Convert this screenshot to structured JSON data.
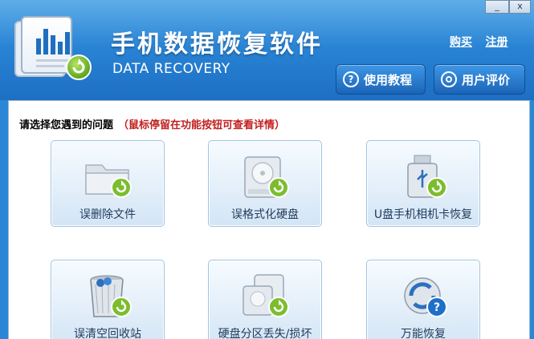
{
  "header": {
    "title": "手机数据恢复软件",
    "subtitle": "DATA RECOVERY",
    "links": {
      "buy": "购买",
      "register": "注册"
    },
    "tutorial_label": "使用教程",
    "review_label": "用户评价",
    "accent_color": "#2b86d6"
  },
  "window": {
    "minimize": "_",
    "close": "x"
  },
  "main": {
    "prompt": "请选择您遇到的问题",
    "hint": "（鼠标停留在功能按钮可查看详情）",
    "hint_color": "#c21f1f",
    "tiles": [
      {
        "label": "误删除文件",
        "icon": "folder-recover-icon"
      },
      {
        "label": "误格式化硬盘",
        "icon": "hard-drive-recover-icon"
      },
      {
        "label": "U盘手机相机卡恢复",
        "icon": "usb-recover-icon"
      },
      {
        "label": "误清空回收站",
        "icon": "recycle-bin-recover-icon"
      },
      {
        "label": "硬盘分区丢失/损坏",
        "icon": "partition-recover-icon"
      },
      {
        "label": "万能恢复",
        "icon": "universal-recover-icon"
      }
    ]
  }
}
